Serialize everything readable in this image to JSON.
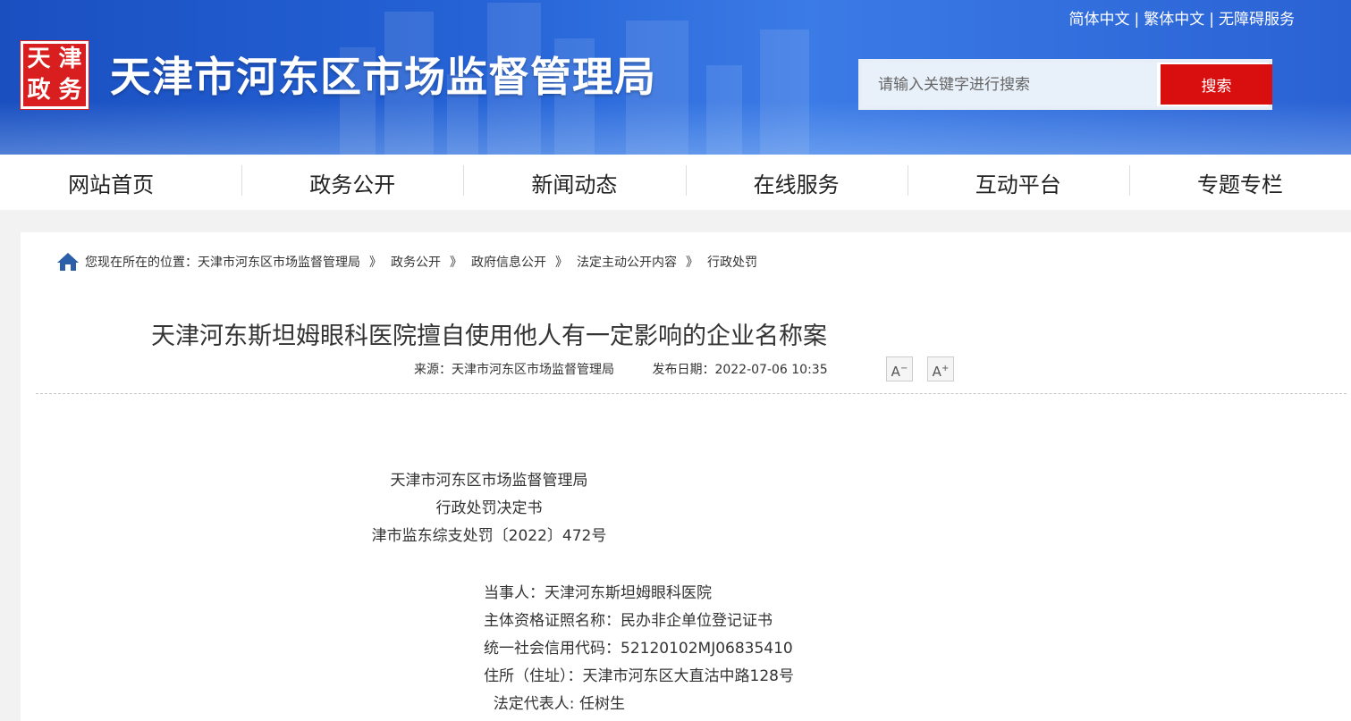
{
  "header": {
    "logo_chars": [
      "天",
      "津",
      "政",
      "务"
    ],
    "site_title": "天津市河东区市场监督管理局",
    "lang_links": [
      "简体中文",
      "繁体中文",
      "无障碍服务"
    ],
    "search_placeholder": "请输入关键字进行搜索",
    "search_button": "搜索"
  },
  "nav": [
    "网站首页",
    "政务公开",
    "新闻动态",
    "在线服务",
    "互动平台",
    "专题专栏"
  ],
  "breadcrumb": {
    "prefix": "您现在所在的位置：",
    "items": [
      "天津市河东区市场监督管理局",
      "政务公开",
      "政府信息公开",
      "法定主动公开内容",
      "行政处罚"
    ],
    "separator": "》"
  },
  "article": {
    "title": "天津河东斯坦姆眼科医院擅自使用他人有一定影响的企业名称案",
    "source_label": "来源：",
    "source": "天津市河东区市场监督管理局",
    "date_label": "发布日期：",
    "date": "2022-07-06 10:35",
    "font_decrease": "A",
    "font_decrease_sign": "−",
    "font_increase": "A",
    "font_increase_sign": "+"
  },
  "document": {
    "head": [
      "天津市河东区市场监督管理局",
      "行政处罚决定书",
      "津市监东综支处罚〔2022〕472号"
    ],
    "body": [
      "当事人：天津河东斯坦姆眼科医院",
      "主体资格证照名称：民办非企单位登记证书",
      "统一社会信用代码：52120102MJ06835410",
      "住所（住址）：天津市河东区大直沽中路128号",
      "  法定代表人: 任树生"
    ]
  },
  "colors": {
    "header_blue": "#2563d6",
    "search_button": "#d90f0f",
    "logo_red": "#d81e1e"
  }
}
